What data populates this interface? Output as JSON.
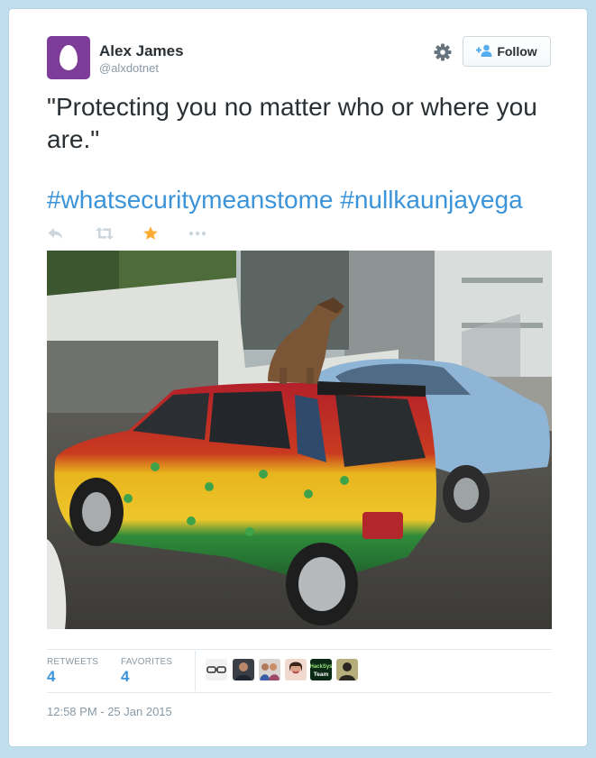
{
  "tweet": {
    "author_name": "Alex James",
    "author_handle": "@alxdotnet",
    "follow_label": "Follow",
    "text": "\"Protecting you no matter who or where you are.\"",
    "hashtags": [
      "#whatsecuritymeanstome",
      "#nullkaunjayega"
    ],
    "retweets_label": "RETWEETS",
    "retweets_count": "4",
    "favorites_label": "FAVORITES",
    "favorites_count": "4",
    "timestamp": "12:58 PM - 25 Jan 2015",
    "favoriter_badge_text": "HackSys Team"
  },
  "colors": {
    "link": "#3b94d9",
    "star": "#ffac33",
    "text": "#292f33",
    "muted": "#8899a6",
    "avatar_bg": "#7d3c98"
  },
  "icons": [
    "gear-icon",
    "follow-person-plus-icon",
    "reply-icon",
    "retweet-icon",
    "favorite-star-icon",
    "more-icon"
  ]
}
